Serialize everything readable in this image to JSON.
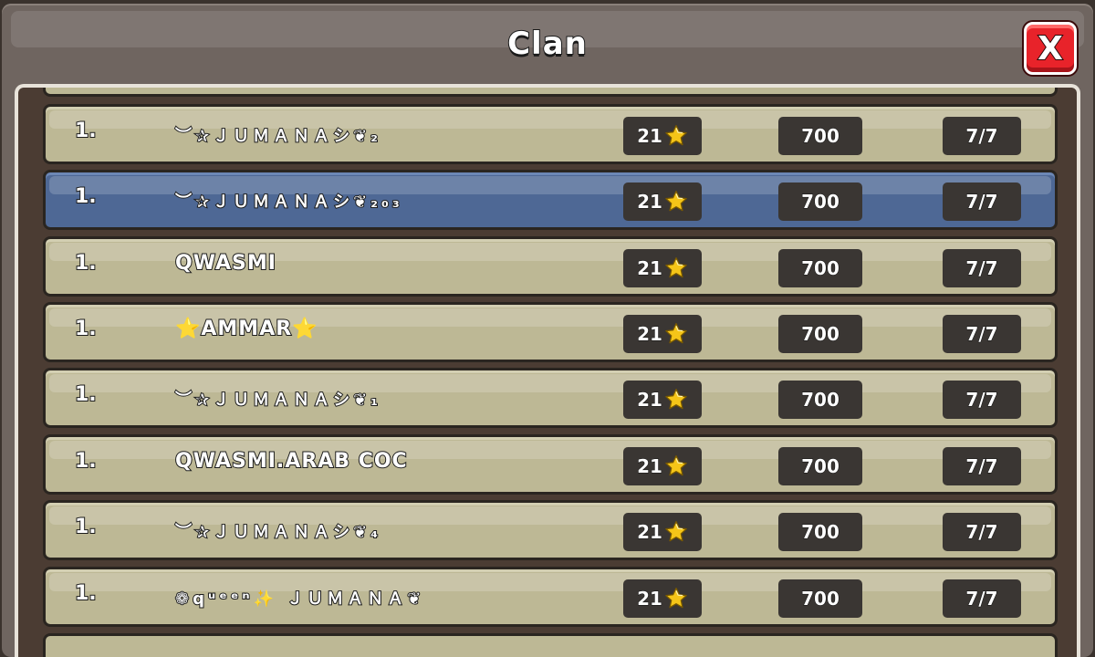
{
  "window": {
    "title": "Clan",
    "close_label": "X"
  },
  "rows": [
    {
      "rank": "1.",
      "name": "︶✰ＪＵＭＡＮＡシ❦₂",
      "stars": "21",
      "trophies": "700",
      "attacks": "7/7",
      "highlighted": false
    },
    {
      "rank": "1.",
      "name": "︶✰ＪＵＭＡＮＡシ❦₂₀₃",
      "stars": "21",
      "trophies": "700",
      "attacks": "7/7",
      "highlighted": true
    },
    {
      "rank": "1.",
      "name": "QWASMI",
      "stars": "21",
      "trophies": "700",
      "attacks": "7/7",
      "highlighted": false
    },
    {
      "rank": "1.",
      "name": "⭐AMMAR⭐",
      "stars": "21",
      "trophies": "700",
      "attacks": "7/7",
      "highlighted": false
    },
    {
      "rank": "1.",
      "name": "︶✰ＪＵＭＡＮＡシ❦₁",
      "stars": "21",
      "trophies": "700",
      "attacks": "7/7",
      "highlighted": false
    },
    {
      "rank": "1.",
      "name": "QWASMI.ARAB COC",
      "stars": "21",
      "trophies": "700",
      "attacks": "7/7",
      "highlighted": false
    },
    {
      "rank": "1.",
      "name": "︶✰ＪＵＭＡＮＡシ❦₄",
      "stars": "21",
      "trophies": "700",
      "attacks": "7/7",
      "highlighted": false
    },
    {
      "rank": "1.",
      "name": "❁qᵘᵉᵉⁿ✨ ＪＵＭＡＮＡ❦",
      "stars": "21",
      "trophies": "700",
      "attacks": "7/7",
      "highlighted": false
    }
  ],
  "icons": {
    "star": "star-icon",
    "close": "close-icon"
  },
  "colors": {
    "row": "#bdb895",
    "row_highlight": "#4e6895",
    "close": "#e8232a",
    "star": "#f5c518"
  }
}
